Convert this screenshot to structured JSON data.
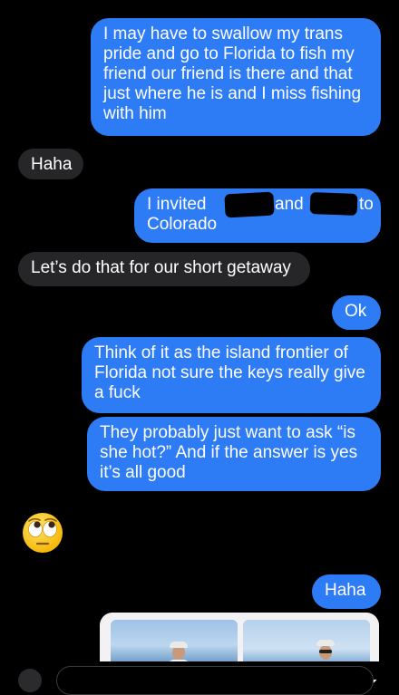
{
  "messages": [
    {
      "from": "me",
      "text": "I may have to swallow my trans pride and go to Florida to fish my friend our friend is there and that just where he is and I miss fishing with him"
    },
    {
      "from": "them",
      "text": "Haha"
    },
    {
      "from": "me",
      "text_a": "I invited",
      "text_b": "and",
      "text_c": "to",
      "text_d": "Colorado"
    },
    {
      "from": "them",
      "text": "Let’s do that for our short getaway"
    },
    {
      "from": "me",
      "text": "Ok"
    },
    {
      "from": "me",
      "text": "Think of it as the island frontier of Florida not sure the keys really give a fuck"
    },
    {
      "from": "me",
      "text": "They probably just want to ask “is she hot?” And if the answer is yes it’s all good"
    },
    {
      "from": "them",
      "emoji": "🙄"
    },
    {
      "from": "me",
      "text": "Haha"
    }
  ],
  "colors": {
    "background": "#000000",
    "sent_bubble": "#2e7bf6",
    "received_bubble": "#262628",
    "text": "#ffffff"
  },
  "icons": {
    "emoji": "face-with-rolling-eyes",
    "plus": "plus-icon"
  }
}
